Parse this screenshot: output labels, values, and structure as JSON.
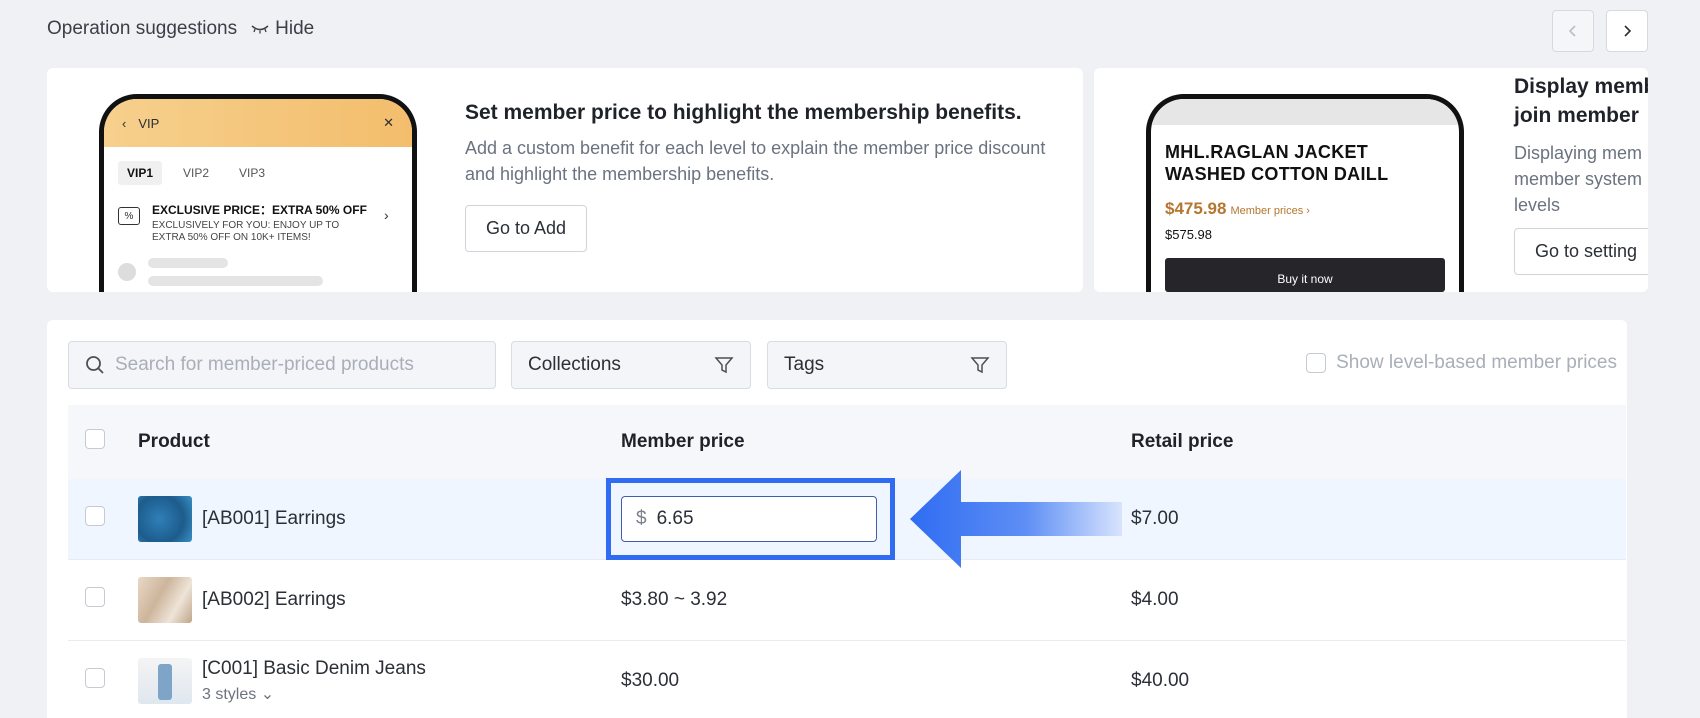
{
  "header": {
    "title": "Operation suggestions",
    "hide_label": "Hide"
  },
  "cards": [
    {
      "phone": {
        "header": "VIP",
        "tabs": [
          "VIP1",
          "VIP2",
          "VIP3"
        ],
        "offer_title": "EXCLUSIVE PRICE：EXTRA 50% OFF",
        "offer_desc": "EXCLUSIVELY FOR YOU: ENJOY UP TO EXTRA 50% OFF ON 10K+ ITEMS!"
      },
      "title": "Set member price to highlight the membership benefits.",
      "desc": "Add a custom benefit for each level to explain the member price discount and highlight the membership benefits.",
      "button": "Go to Add"
    },
    {
      "phone": {
        "product": "MHL.RAGLAN JACKET WASHED COTTON DAILL",
        "member_price": "$475.98",
        "member_label": "Member prices ›",
        "retail": "$575.98",
        "buy": "Buy it now"
      },
      "title_l1": "Display memb",
      "title_l2": "join member",
      "desc_l1": "Displaying mem",
      "desc_l2": "member system",
      "desc_l3": "levels",
      "button": "Go to setting"
    }
  ],
  "filters": {
    "search_placeholder": "Search for member-priced products",
    "collections": "Collections",
    "tags": "Tags",
    "show_level": "Show level-based member prices"
  },
  "table": {
    "headers": {
      "product": "Product",
      "member": "Member price",
      "retail": "Retail price"
    },
    "rows": [
      {
        "name": "[AB001] Earrings",
        "member_currency": "$",
        "member_value": "6.65",
        "retail": "$7.00"
      },
      {
        "name": "[AB002] Earrings",
        "member": "$3.80 ~ 3.92",
        "retail": "$4.00"
      },
      {
        "name": "[C001] Basic Denim Jeans",
        "styles": "3 styles ⌄",
        "member": "$30.00",
        "retail": "$40.00"
      }
    ]
  },
  "colors": {
    "accent": "#2f6cf2",
    "price": "#b5762f"
  }
}
